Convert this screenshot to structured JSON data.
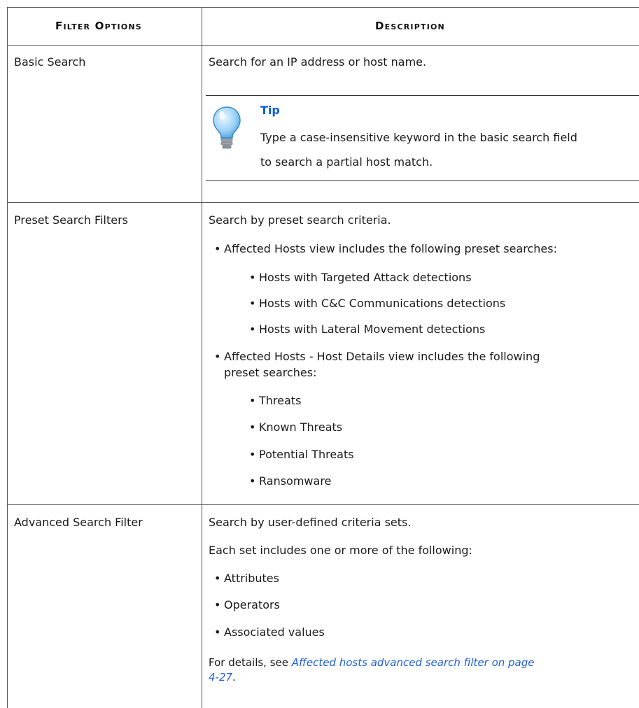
{
  "headers": {
    "filter_options": "Filter Options",
    "description": "Description"
  },
  "rows": {
    "basic": {
      "label": "Basic Search",
      "desc": "Search for an IP address or host name.",
      "tip": {
        "title": "Tip",
        "line1": "Type a case-insensitive keyword in the basic search field",
        "line2": "to search a partial host match."
      }
    },
    "preset": {
      "label": "Preset Search Filters",
      "desc": "Search by preset search criteria.",
      "bullet1": "Affected Hosts view includes the following preset searches:",
      "sub1": [
        "Hosts with Targeted Attack detections",
        "Hosts with C&C Communications detections",
        "Hosts with Lateral Movement detections"
      ],
      "bullet2_line1": "Affected Hosts - Host Details view includes the following",
      "bullet2_line2": "preset searches:",
      "sub2": [
        "Threats",
        "Known Threats",
        "Potential Threats",
        "Ransomware"
      ]
    },
    "advanced": {
      "label": "Advanced Search Filter",
      "desc": "Search by user-defined criteria sets.",
      "desc2": "Each set includes one or more of the following:",
      "items": [
        "Attributes",
        "Operators",
        "Associated values"
      ],
      "details_prefix": "For details, see ",
      "details_link_line1": "Affected hosts advanced search filter on page",
      "details_link_line2": "4-27",
      "details_suffix": "."
    }
  },
  "colors": {
    "link": "#1f5fd6",
    "tip_title": "#0a5adf",
    "border": "#555555"
  }
}
